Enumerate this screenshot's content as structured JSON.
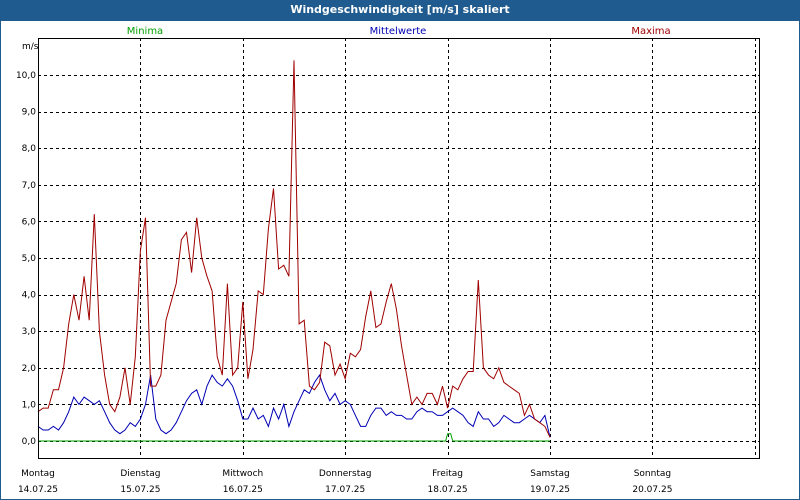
{
  "window": {
    "title": "Windgeschwindigkeit [m/s] skaliert"
  },
  "colors": {
    "minima": "#00a000",
    "mittel": "#0000b4",
    "maxima": "#a00000",
    "titlebar": "#1f5b8e"
  },
  "chart_data": {
    "type": "line",
    "title": "Windgeschwindigkeit [m/s] skaliert",
    "ylabel": "m/s",
    "ylim": [
      0,
      11
    ],
    "yticks": [
      "0,0",
      "1,0",
      "2,0",
      "3,0",
      "4,0",
      "5,0",
      "6,0",
      "7,0",
      "8,0",
      "9,0",
      "10,0"
    ],
    "xlim": [
      0,
      7
    ],
    "days": [
      {
        "name": "Montag",
        "date": "14.07.25"
      },
      {
        "name": "Dienstag",
        "date": "15.07.25"
      },
      {
        "name": "Mittwoch",
        "date": "16.07.25"
      },
      {
        "name": "Donnerstag",
        "date": "17.07.25"
      },
      {
        "name": "Freitag",
        "date": "18.07.25"
      },
      {
        "name": "Samstag",
        "date": "19.07.25"
      },
      {
        "name": "Sonntag",
        "date": "20.07.25"
      }
    ],
    "series": [
      {
        "name": "Minima",
        "x": [
          0,
          3.98,
          4.0,
          4.03,
          4.05,
          5.0
        ],
        "values": [
          0.0,
          0.0,
          0.2,
          0.2,
          0.0,
          0.0
        ]
      },
      {
        "name": "Mittelwerte",
        "x": [
          0,
          0.05,
          0.1,
          0.15,
          0.2,
          0.25,
          0.3,
          0.35,
          0.4,
          0.45,
          0.5,
          0.55,
          0.6,
          0.65,
          0.7,
          0.75,
          0.8,
          0.85,
          0.9,
          0.95,
          1.0,
          1.05,
          1.1,
          1.15,
          1.2,
          1.25,
          1.3,
          1.35,
          1.4,
          1.45,
          1.5,
          1.55,
          1.6,
          1.65,
          1.7,
          1.75,
          1.8,
          1.85,
          1.9,
          1.95,
          2.0,
          2.05,
          2.1,
          2.15,
          2.2,
          2.25,
          2.3,
          2.35,
          2.4,
          2.45,
          2.5,
          2.55,
          2.6,
          2.65,
          2.7,
          2.75,
          2.8,
          2.85,
          2.9,
          2.95,
          3.0,
          3.05,
          3.1,
          3.15,
          3.2,
          3.25,
          3.3,
          3.35,
          3.4,
          3.45,
          3.5,
          3.55,
          3.6,
          3.65,
          3.7,
          3.75,
          3.8,
          3.85,
          3.9,
          3.95,
          4.0,
          4.05,
          4.1,
          4.15,
          4.2,
          4.25,
          4.3,
          4.35,
          4.4,
          4.45,
          4.5,
          4.55,
          4.6,
          4.65,
          4.7,
          4.75,
          4.8,
          4.85,
          4.9,
          4.95,
          5.0
        ],
        "values": [
          0.4,
          0.3,
          0.3,
          0.4,
          0.3,
          0.5,
          0.8,
          1.2,
          1.0,
          1.2,
          1.1,
          1.0,
          1.1,
          0.8,
          0.5,
          0.3,
          0.2,
          0.3,
          0.5,
          0.4,
          0.6,
          1.0,
          1.8,
          0.6,
          0.3,
          0.2,
          0.3,
          0.5,
          0.8,
          1.1,
          1.3,
          1.4,
          1.0,
          1.5,
          1.8,
          1.6,
          1.5,
          1.7,
          1.5,
          1.1,
          0.6,
          0.6,
          0.9,
          0.6,
          0.7,
          0.4,
          0.9,
          0.6,
          1.0,
          0.4,
          0.8,
          1.1,
          1.4,
          1.3,
          1.6,
          1.8,
          1.4,
          1.1,
          1.3,
          1.0,
          1.1,
          1.0,
          0.7,
          0.4,
          0.4,
          0.7,
          0.9,
          0.9,
          0.7,
          0.8,
          0.7,
          0.7,
          0.6,
          0.6,
          0.8,
          0.9,
          0.8,
          0.8,
          0.7,
          0.7,
          0.8,
          0.9,
          0.8,
          0.7,
          0.5,
          0.4,
          0.8,
          0.6,
          0.6,
          0.4,
          0.5,
          0.7,
          0.6,
          0.5,
          0.5,
          0.6,
          0.7,
          0.6,
          0.5,
          0.7,
          0.1
        ]
      },
      {
        "name": "Maxima",
        "x": [
          0,
          0.05,
          0.1,
          0.15,
          0.2,
          0.25,
          0.3,
          0.35,
          0.4,
          0.45,
          0.5,
          0.55,
          0.6,
          0.65,
          0.7,
          0.75,
          0.8,
          0.85,
          0.9,
          0.95,
          1.0,
          1.05,
          1.1,
          1.15,
          1.2,
          1.25,
          1.3,
          1.35,
          1.4,
          1.45,
          1.5,
          1.55,
          1.6,
          1.65,
          1.7,
          1.75,
          1.8,
          1.85,
          1.9,
          1.95,
          2.0,
          2.05,
          2.1,
          2.15,
          2.2,
          2.25,
          2.3,
          2.35,
          2.4,
          2.45,
          2.5,
          2.55,
          2.6,
          2.65,
          2.7,
          2.75,
          2.8,
          2.85,
          2.9,
          2.95,
          3.0,
          3.05,
          3.1,
          3.15,
          3.2,
          3.25,
          3.3,
          3.35,
          3.4,
          3.45,
          3.5,
          3.55,
          3.6,
          3.65,
          3.7,
          3.75,
          3.8,
          3.85,
          3.9,
          3.95,
          4.0,
          4.05,
          4.1,
          4.15,
          4.2,
          4.25,
          4.3,
          4.35,
          4.4,
          4.45,
          4.5,
          4.55,
          4.6,
          4.65,
          4.7,
          4.75,
          4.8,
          4.85,
          4.9,
          4.95,
          5.0
        ],
        "values": [
          0.8,
          0.9,
          0.9,
          1.4,
          1.4,
          2.0,
          3.2,
          4.0,
          3.3,
          4.5,
          3.3,
          6.2,
          3.0,
          1.8,
          1.0,
          0.8,
          1.2,
          2.0,
          1.0,
          2.3,
          5.2,
          6.1,
          1.5,
          1.5,
          1.8,
          3.3,
          3.8,
          4.3,
          5.5,
          5.7,
          4.6,
          6.1,
          5.0,
          4.5,
          4.1,
          2.3,
          1.8,
          4.3,
          1.8,
          2.0,
          3.8,
          1.7,
          2.5,
          4.1,
          4.0,
          5.8,
          6.9,
          4.7,
          4.8,
          4.5,
          10.4,
          3.2,
          3.3,
          1.5,
          1.4,
          1.6,
          2.7,
          2.6,
          1.8,
          2.1,
          1.7,
          2.4,
          2.3,
          2.5,
          3.4,
          4.1,
          3.1,
          3.2,
          3.8,
          4.3,
          3.6,
          2.6,
          1.8,
          1.0,
          1.2,
          1.0,
          1.3,
          1.3,
          1.0,
          1.5,
          0.9,
          1.5,
          1.4,
          1.7,
          1.9,
          1.9,
          4.4,
          2.0,
          1.8,
          1.7,
          2.0,
          1.6,
          1.5,
          1.4,
          1.3,
          0.7,
          1.0,
          0.6,
          0.5,
          0.4,
          0.1
        ]
      }
    ]
  }
}
